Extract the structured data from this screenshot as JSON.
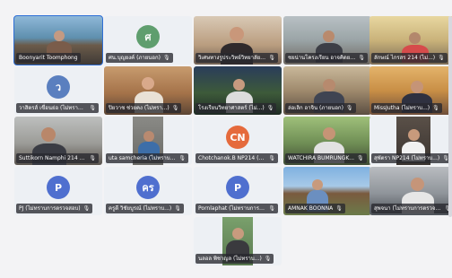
{
  "meeting": {
    "participants": [
      {
        "name": "Boonyarit Toomphong",
        "muted": false,
        "type": "video",
        "speaking": true
      },
      {
        "name": "ศน.บุญยงค์ (ภายนอก)",
        "muted": true,
        "type": "avatar",
        "initials": "ศ",
        "avatar_color": "#5f9e6e"
      },
      {
        "name": "วิเศษทางรูประวิทย์วิทยาลัยแห่งชาติ (ไม่...)",
        "muted": true,
        "type": "video"
      },
      {
        "name": "ชยน่านโครงเรียน อาจคิดยา (ไม่...)",
        "muted": true,
        "type": "video"
      },
      {
        "name": "ลักษณ์ ไกรสร 214 (ไม่...)",
        "muted": true,
        "type": "video"
      },
      {
        "name": "วาสิตรส์ เขื่อนย่อ (ไม่ทราบ...)",
        "muted": true,
        "type": "avatar",
        "initials": "ว",
        "avatar_color": "#5a7fbf"
      },
      {
        "name": "ปิยวาช ช่วยคง (ไม่ทรา...)",
        "muted": true,
        "type": "video"
      },
      {
        "name": "โรงเรียนวิทยาศาสตร์ (ไม่...)",
        "muted": true,
        "type": "video"
      },
      {
        "name": "ล่อเลิก อาจิน (ภายนอก)",
        "muted": true,
        "type": "video"
      },
      {
        "name": "MissJutha (ไม่ทราบ...)",
        "muted": true,
        "type": "video"
      },
      {
        "name": "Suttikorn Namphi 214 (ไม่...)",
        "muted": true,
        "type": "video"
      },
      {
        "name": "uta samcheria (ไม่ทราบ...)",
        "muted": true,
        "type": "video"
      },
      {
        "name": "Chotchanok.B NP214 (ไม่...)",
        "muted": true,
        "type": "avatar",
        "initials": "CN",
        "avatar_color": "#e56a3c"
      },
      {
        "name": "WATCHIRA BUMRUNGK...",
        "muted": true,
        "type": "video"
      },
      {
        "name": "สุพัตรา NP214 (ไม่ทราบ...)",
        "muted": true,
        "type": "video"
      },
      {
        "name": "PJ (ไม่ทราบการตรวจสอบ)",
        "muted": true,
        "type": "avatar",
        "initials": "P",
        "avatar_color": "#4f6fcf"
      },
      {
        "name": "ครูดี วิชัยบูรณ์ (ไม่ทราบ...)",
        "muted": true,
        "type": "avatar",
        "initials": "คร",
        "avatar_color": "#4f6fcf"
      },
      {
        "name": "Pornlaphat (ไม่ทราบการ...)",
        "muted": true,
        "type": "avatar",
        "initials": "P",
        "avatar_color": "#4f6fcf"
      },
      {
        "name": "AMNAK BOONNA",
        "muted": true,
        "type": "video"
      },
      {
        "name": "สุพจนา (ไม่ทราบการตรวจสอบ)",
        "muted": true,
        "type": "video"
      },
      {
        "name": "นลอล พิชาญล (ไม่ทราบ...)",
        "muted": true,
        "type": "video"
      }
    ],
    "more_icon": "ellipsis-icon",
    "mic_off_icon": "mic-off-icon"
  }
}
